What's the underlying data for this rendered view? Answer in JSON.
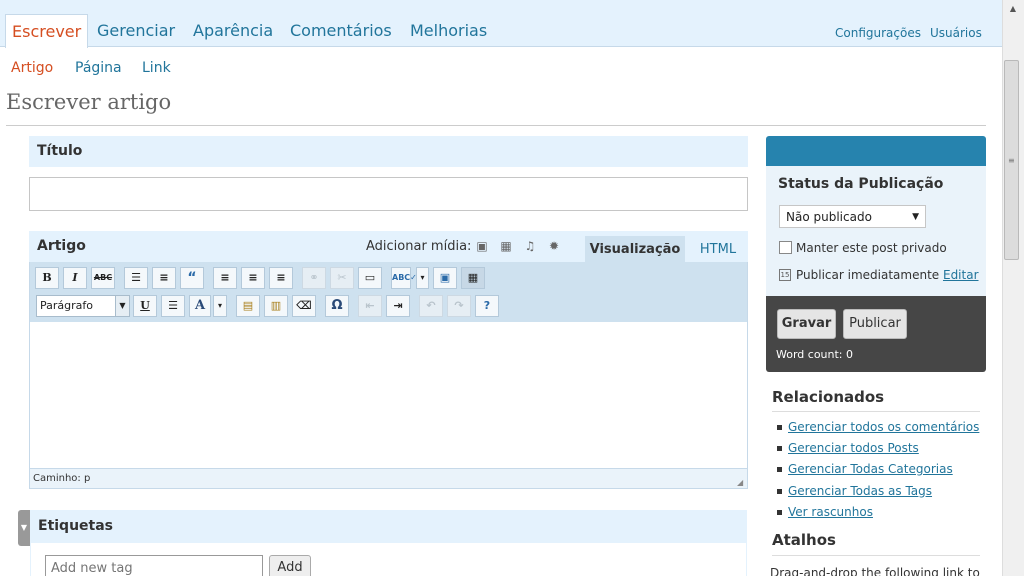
{
  "nav": {
    "tabs": [
      "Escrever",
      "Gerenciar",
      "Aparência",
      "Comentários",
      "Melhorias"
    ],
    "util": [
      "Configurações",
      "Usuários"
    ],
    "sub": [
      "Artigo",
      "Página",
      "Link"
    ]
  },
  "page_title": "Escrever artigo",
  "title_box": {
    "label": "Título",
    "value": ""
  },
  "editor": {
    "label": "Artigo",
    "media_label": "Adicionar mídia:",
    "tab_visual": "Visualização",
    "tab_html": "HTML",
    "format_select": "Parágrafo",
    "path": "Caminho: p",
    "content": ""
  },
  "tags": {
    "label": "Etiquetas",
    "placeholder": "Add new tag",
    "add_button": "Add"
  },
  "publish": {
    "title": "Status da Publicação",
    "status_value": "Não publicado",
    "private_label": "Manter este post privado",
    "private_checked": false,
    "publish_when": "Publicar imediatamente",
    "edit_link": "Editar",
    "save_button": "Gravar",
    "publish_button": "Publicar",
    "word_count": "Word count: 0"
  },
  "related": {
    "title": "Relacionados",
    "links": [
      "Gerenciar todos os comentários",
      "Gerenciar todos Posts",
      "Gerenciar Todas Categorias",
      "Gerenciar Todas as Tags",
      "Ver rascunhos"
    ]
  },
  "shortcuts": {
    "title": "Atalhos",
    "text": "Drag-and-drop the following link to"
  },
  "colors": {
    "accent": "#21759b",
    "active": "#d54e21",
    "nav_bg": "#e4f2fd",
    "publish_header": "#2683ae",
    "publish_footer": "#464646"
  }
}
